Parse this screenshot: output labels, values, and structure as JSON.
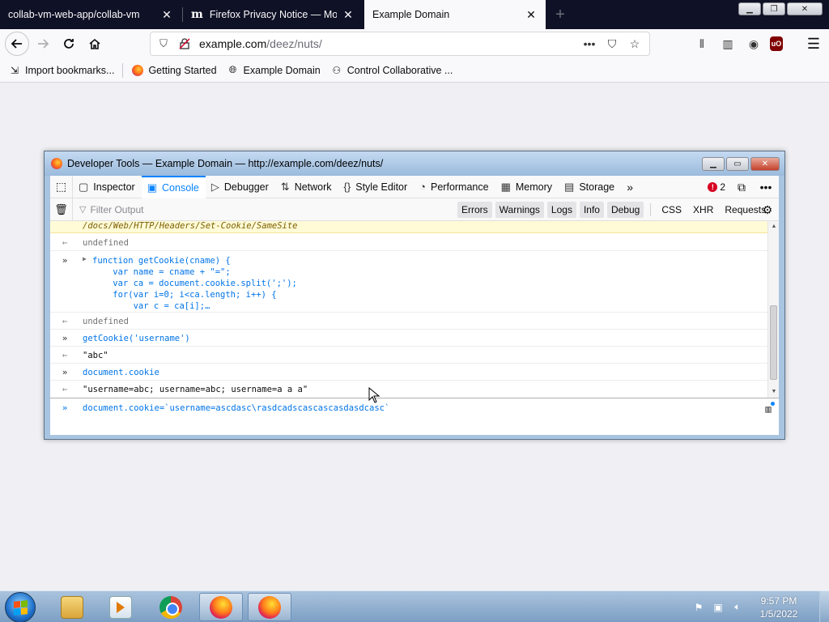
{
  "browser": {
    "tabs": [
      {
        "title": "collab-vm-web-app/collab-vm",
        "active": false
      },
      {
        "title": "Firefox Privacy Notice — Mozilla",
        "active": false
      },
      {
        "title": "Example Domain",
        "active": true
      }
    ],
    "url_host": "example.com",
    "url_path": "/deez/nuts/",
    "bookmarks": [
      {
        "label": "Import bookmarks...",
        "icon": "import-icon"
      },
      {
        "label": "Getting Started",
        "icon": "firefox-icon"
      },
      {
        "label": "Example Domain",
        "icon": "globe-icon"
      },
      {
        "label": "Control Collaborative ...",
        "icon": "collabvm-icon"
      }
    ]
  },
  "devtools": {
    "window_title": "Developer Tools — Example Domain — http://example.com/deez/nuts/",
    "tabs": [
      {
        "label": "Inspector",
        "icon": "inspector-icon"
      },
      {
        "label": "Console",
        "icon": "console-icon",
        "active": true
      },
      {
        "label": "Debugger",
        "icon": "debugger-icon"
      },
      {
        "label": "Network",
        "icon": "network-icon"
      },
      {
        "label": "Style Editor",
        "icon": "style-editor-icon"
      },
      {
        "label": "Performance",
        "icon": "performance-icon"
      },
      {
        "label": "Memory",
        "icon": "memory-icon"
      },
      {
        "label": "Storage",
        "icon": "storage-icon"
      }
    ],
    "error_count": "2",
    "filter_placeholder": "Filter Output",
    "levels": [
      "Errors",
      "Warnings",
      "Logs",
      "Info",
      "Debug"
    ],
    "extra_filters": [
      "CSS",
      "XHR",
      "Requests"
    ],
    "warning_line": "/docs/Web/HTTP/Headers/Set-Cookie/SameSite",
    "console": {
      "undefined": "undefined",
      "fn_lines": [
        "function getCookie(cname) {",
        "    var name = cname + \"=\";",
        "    var ca = document.cookie.split(';');",
        "    for(var i=0; i<ca.length; i++) {",
        "        var c = ca[i];…"
      ],
      "call1": "getCookie('username')",
      "result1": "\"abc\"",
      "call2": "document.cookie",
      "result2": "\"username=abc; username=abc; username=a a a\"",
      "input": "document.cookie=`username=ascdasc\\rasdcadscascascasdasdcasc`"
    }
  },
  "taskbar": {
    "time": "9:57 PM",
    "date": "1/5/2022"
  }
}
